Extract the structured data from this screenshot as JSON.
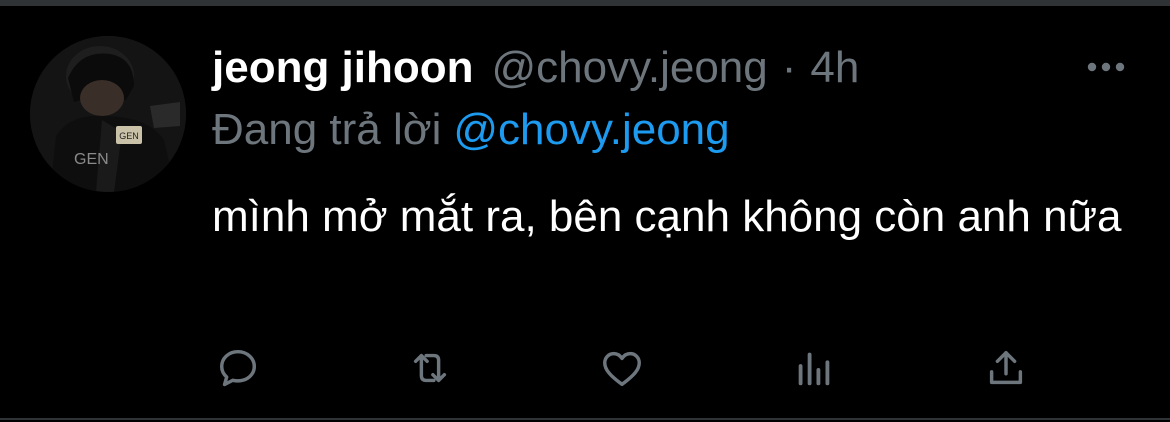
{
  "tweet": {
    "display_name": "jeong jihoon",
    "handle": "@chovy.jeong",
    "separator": "·",
    "timestamp": "4h",
    "replying_label": "Đang trả lời",
    "replying_to": "@chovy.jeong",
    "text": "mình mở mắt ra, bên cạnh không còn anh nữa"
  },
  "icons": {
    "more": "more-horizontal-icon",
    "reply": "reply-icon",
    "retweet": "retweet-icon",
    "like": "heart-icon",
    "analytics": "analytics-icon",
    "share": "share-icon"
  },
  "colors": {
    "background": "#000000",
    "text_primary": "#ffffff",
    "text_secondary": "#6e767d",
    "accent": "#1d9bf0",
    "icon": "#6e767d",
    "divider": "#2f3336"
  }
}
